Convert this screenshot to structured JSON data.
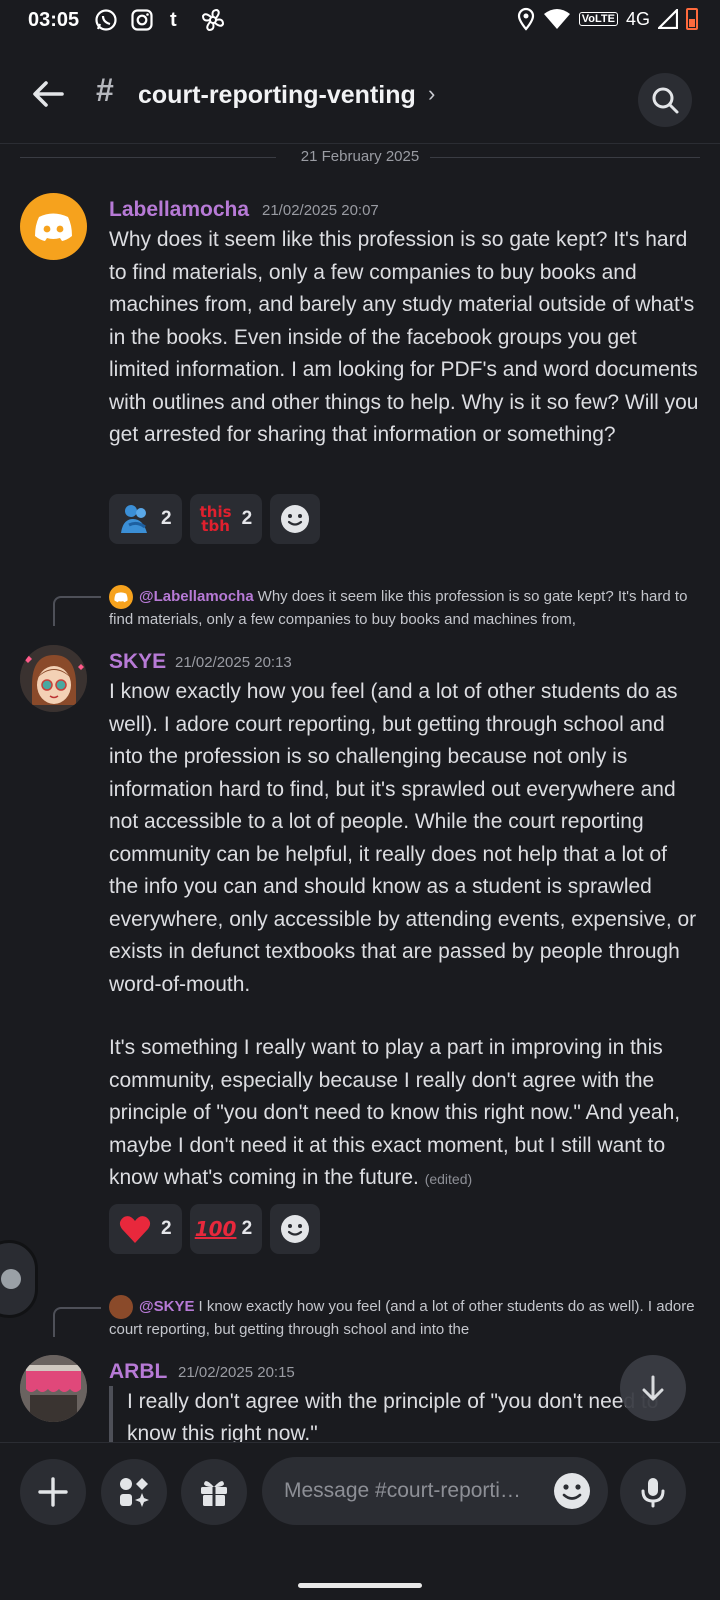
{
  "status_bar": {
    "time": "03:05",
    "volte": "VoLTE",
    "network": "4G",
    "app_icons": [
      "whatsapp-icon",
      "instagram-icon",
      "tumblr-icon",
      "pinwheel-icon"
    ]
  },
  "header": {
    "channel": "court-reporting-venting",
    "hash": "#"
  },
  "date_divider": "21 February 2025",
  "messages": [
    {
      "author": "Labellamocha",
      "timestamp": "21/02/2025 20:07",
      "text": "Why does it seem like this profession is so gate kept? It's hard to find materials, only a few companies to buy books and machines from, and barely any study material outside of what's in the books. Even inside of the facebook groups you get limited information. I am looking for PDF's and word documents with outlines and other things to help. Why is it so few? Will you get arrested for sharing that information or something?",
      "reactions": [
        {
          "emoji": "people-hugging",
          "count": "2"
        },
        {
          "emoji": "this-tbh",
          "count": "2"
        }
      ]
    },
    {
      "reply_to": "@Labellamocha",
      "reply_text": "Why does it seem like this profession is so gate kept? It's hard to find materials, only a few companies to buy books and machines from,",
      "author": "SKYE",
      "timestamp": "21/02/2025 20:13",
      "text_p1": "I know exactly how you feel (and a lot of other students do as well). I adore court reporting, but getting through school and into the profession is so challenging because not only is information hard to find, but it's sprawled out everywhere and not accessible to a lot of people. While the court reporting community can be helpful, it really does not help that a lot of the info you can and should know as a student is sprawled everywhere, only accessible by attending events, expensive, or exists in defunct textbooks that are passed by people through word-of-mouth.",
      "text_p2": "It's something I really want to play a part in improving in this community, especially because I really don't agree with the principle of \"you don't need to know this right now.\" And yeah, maybe I don't need it at this exact moment, but I still want to know what's coming in the future.",
      "edited": "(edited)",
      "reactions": [
        {
          "emoji": "red-heart",
          "count": "2"
        },
        {
          "emoji": "hundred-points",
          "count": "2"
        }
      ]
    },
    {
      "reply_to": "@SKYE",
      "reply_text": "I know exactly how you feel (and a lot of other students do as well). I adore court reporting, but getting through school and into the",
      "author": "ARBL",
      "timestamp": "21/02/2025 20:15",
      "quote": "I really don't agree with the principle of \"you don't need to know this right now.\""
    }
  ],
  "composer": {
    "placeholder": "Message #court-reporti…"
  },
  "colors": {
    "background": "#1a1b1f",
    "author": "#b77ad6",
    "surface": "#2b2d33",
    "discord_orange": "#f6a21d"
  }
}
